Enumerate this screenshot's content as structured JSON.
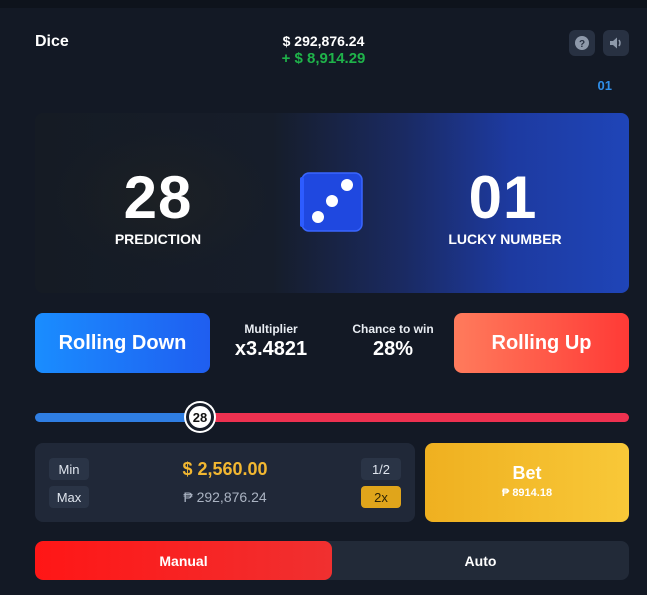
{
  "header": {
    "title": "Dice",
    "balance": "$ 292,876.24",
    "profit": "+ $ 8,914.29",
    "help_icon": "help-icon",
    "sound_icon": "speaker-icon"
  },
  "round_label": "01",
  "result": {
    "prediction_value": "28",
    "prediction_label": "PREDICTION",
    "lucky_value": "01",
    "lucky_label": "LUCKY NUMBER",
    "die_icon": "die-three-icon"
  },
  "controls": {
    "rolling_down": "Rolling Down",
    "rolling_up": "Rolling Up",
    "multiplier_label": "Multiplier",
    "multiplier_value": "x3.4821",
    "chance_label": "Chance to win",
    "chance_value": "28%"
  },
  "slider": {
    "value": "28",
    "min": 0,
    "max": 100,
    "colors": {
      "low": "#2f7ee3",
      "high": "#ee3150"
    }
  },
  "bet": {
    "min_label": "Min",
    "max_label": "Max",
    "half_label": "1/2",
    "double_label": "2x",
    "amount": "$ 2,560.00",
    "amount_alt": "₱ 292,876.24",
    "button_label": "Bet",
    "button_sub": "₱ 8914.18"
  },
  "mode_tabs": {
    "manual": "Manual",
    "auto": "Auto",
    "active": "Manual"
  },
  "colors": {
    "background": "#131925",
    "profit": "#1fb34a",
    "accent_blue": "#1a8dff",
    "accent_red": "#ff3a36",
    "bet_yellow": "#f8c838"
  }
}
